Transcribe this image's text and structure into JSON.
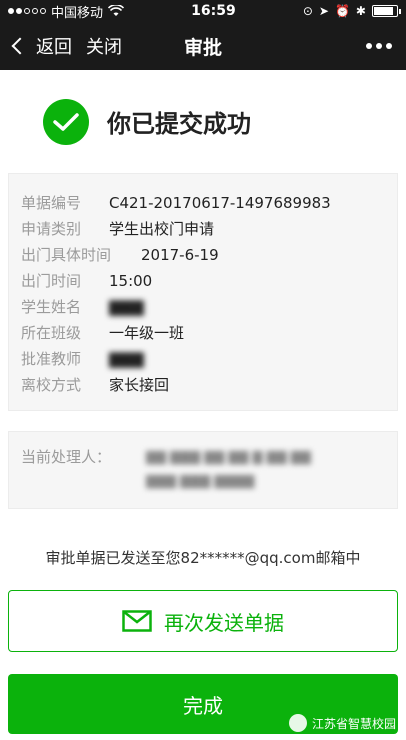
{
  "status_bar": {
    "carrier": "中国移动",
    "time": "16:59",
    "signal_dots_filled": 2,
    "signal_dots_total": 5
  },
  "nav": {
    "back_label": "返回",
    "close_label": "关闭",
    "title": "审批"
  },
  "success": {
    "message": "你已提交成功"
  },
  "details": {
    "rows": [
      {
        "label": "单据编号",
        "value": "C421-20170617-1497689983"
      },
      {
        "label": "申请类别",
        "value": "学生出校门申请"
      },
      {
        "label": "出门具体时间",
        "value": "2017-6-19"
      },
      {
        "label": "出门时间",
        "value": "15:00"
      },
      {
        "label": "学生姓名",
        "value": ""
      },
      {
        "label": "所在班级",
        "value": "一年级一班"
      },
      {
        "label": "批准教师",
        "value": ""
      },
      {
        "label": "离校方式",
        "value": "家长接回"
      }
    ]
  },
  "handler": {
    "label": "当前处理人："
  },
  "sent_note": "审批单据已发送至您82******@qq.com邮箱中",
  "buttons": {
    "resend": "再次发送单据",
    "done": "完成"
  },
  "watermark": "江苏省智慧校园",
  "colors": {
    "accent": "#0bb20c",
    "nav_bg": "#1a1a1a",
    "card_bg": "#f6f6f6"
  }
}
